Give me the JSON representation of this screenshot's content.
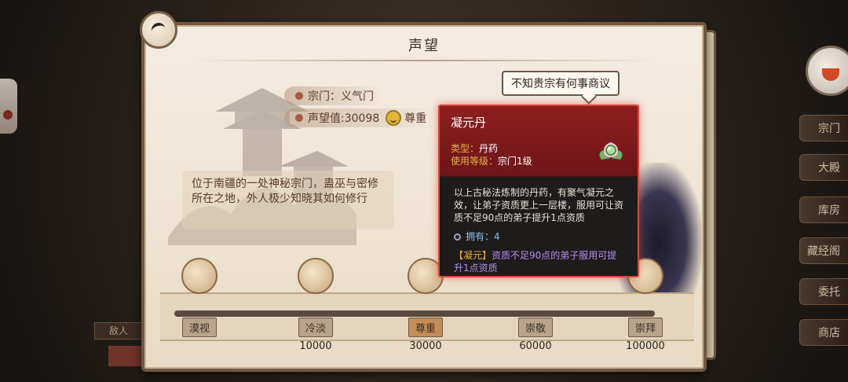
{
  "panel": {
    "title": "声望",
    "sect_label": "宗门：义气门",
    "reputation_label": "声望值:30098",
    "reputation_status": "尊重",
    "speech": "不知贵宗有何事商议",
    "description": "位于南疆的一处神秘宗门，蛊巫与密修所在之地，外人极少知晓其如何修行"
  },
  "milestones": [
    {
      "label": "漠视",
      "value": ""
    },
    {
      "label": "冷淡",
      "value": "10000"
    },
    {
      "label": "尊重",
      "value": "30000"
    },
    {
      "label": "崇敬",
      "value": "60000"
    },
    {
      "label": "崇拜",
      "value": "100000"
    }
  ],
  "tooltip": {
    "name": "凝元丹",
    "type_key": "类型：",
    "type_val": "丹药",
    "level_key": "使用等级：",
    "level_val": "宗门1级",
    "description": "以上古秘法炼制的丹药，有聚气凝元之效，让弟子资质更上一层楼，服用可让资质不足90点的弟子提升1点资质",
    "owned": "拥有：4",
    "effect_tag": "【凝元】",
    "effect_text": "资质不足90点的弟子服用可提升1点资质"
  },
  "sidebar": [
    "宗门",
    "大殿",
    "库房",
    "藏经阁",
    "委托",
    "商店"
  ],
  "bottom_left": "敌人"
}
